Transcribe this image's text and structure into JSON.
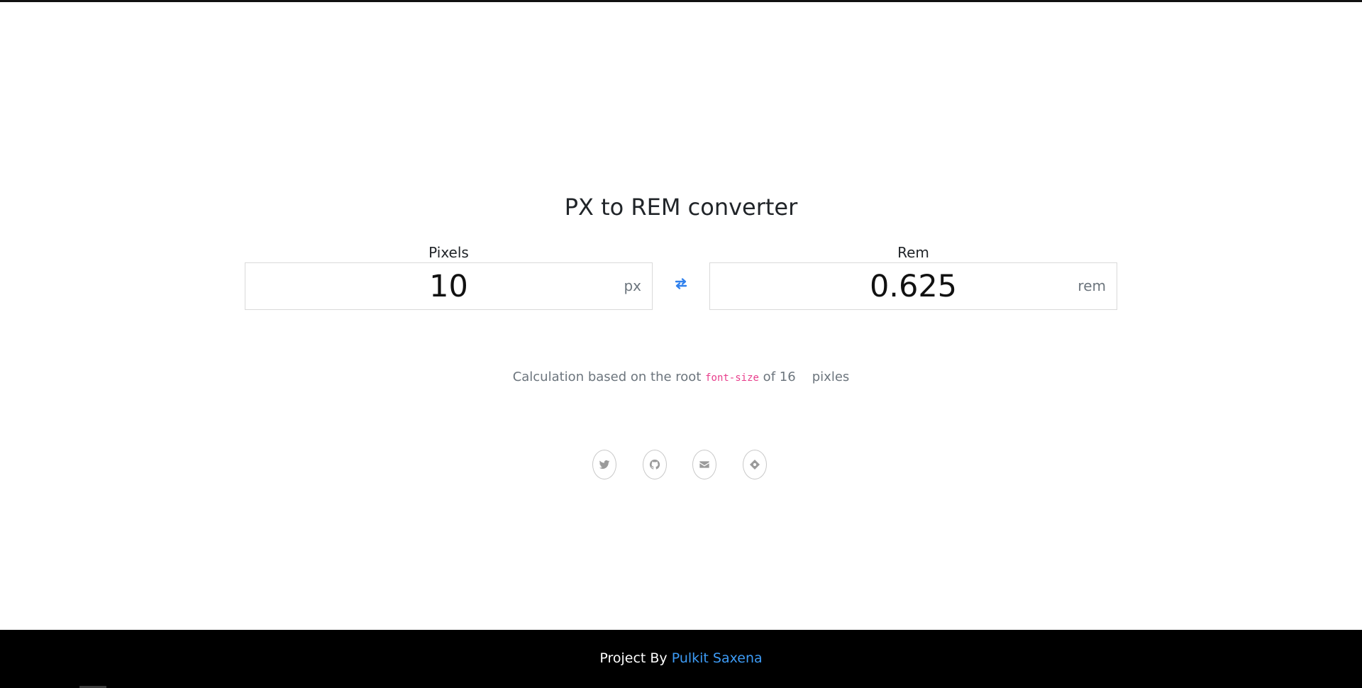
{
  "title": "PX to REM converter",
  "pixels": {
    "label": "Pixels",
    "value": "10",
    "unit": "px"
  },
  "rem": {
    "label": "Rem",
    "value": "0.625",
    "unit": "rem"
  },
  "swap_icon": "exchange-arrows-icon",
  "note": {
    "prefix": "Calculation based on the root ",
    "code": "font-size",
    "middle": " of ",
    "base": "16",
    "suffix": "pixles"
  },
  "socials": [
    {
      "icon": "twitter-icon"
    },
    {
      "icon": "github-icon"
    },
    {
      "icon": "envelope-icon"
    },
    {
      "icon": "portfolio-icon"
    }
  ],
  "footer": {
    "prefix": "Project By ",
    "author": "Pulkit Saxena"
  },
  "colors": {
    "accent": "#2f80ed",
    "link": "#3d9bf5",
    "code": "#e83e8c",
    "muted": "#6c757d",
    "footer_bg": "#000000"
  }
}
